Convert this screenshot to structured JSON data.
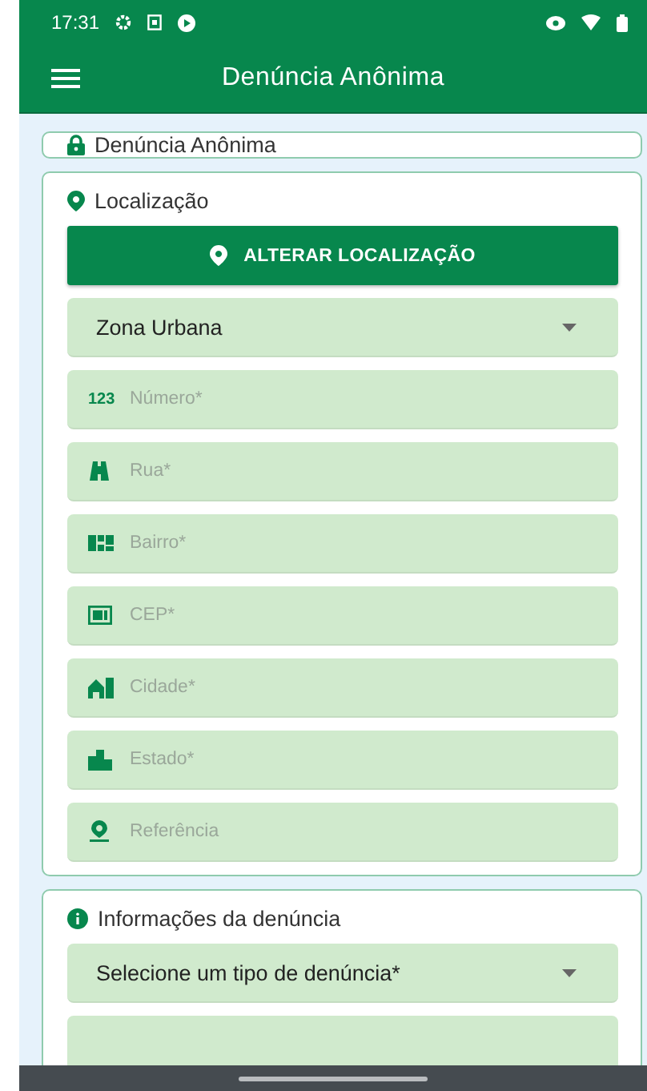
{
  "status_bar": {
    "time": "17:31"
  },
  "app_bar": {
    "title": "Denúncia Anônima"
  },
  "anon_card": {
    "title": "Denúncia Anônima"
  },
  "location_card": {
    "title": "Localização",
    "button": "ALTERAR LOCALIZAÇÃO",
    "fields": [
      {
        "kind": "select",
        "value": "Zona Urbana"
      },
      {
        "kind": "input",
        "icon_label": "123",
        "placeholder": "Número*"
      },
      {
        "kind": "input",
        "placeholder": "Rua*"
      },
      {
        "kind": "input",
        "placeholder": "Bairro*"
      },
      {
        "kind": "input",
        "placeholder": "CEP*"
      },
      {
        "kind": "input",
        "placeholder": "Cidade*"
      },
      {
        "kind": "input",
        "placeholder": "Estado*"
      },
      {
        "kind": "input",
        "placeholder": "Referência"
      }
    ]
  },
  "info_card": {
    "title": "Informações da denúncia",
    "fields": [
      {
        "kind": "select",
        "value": "Selecione um tipo de denúncia*"
      },
      {
        "kind": "input"
      }
    ]
  }
}
